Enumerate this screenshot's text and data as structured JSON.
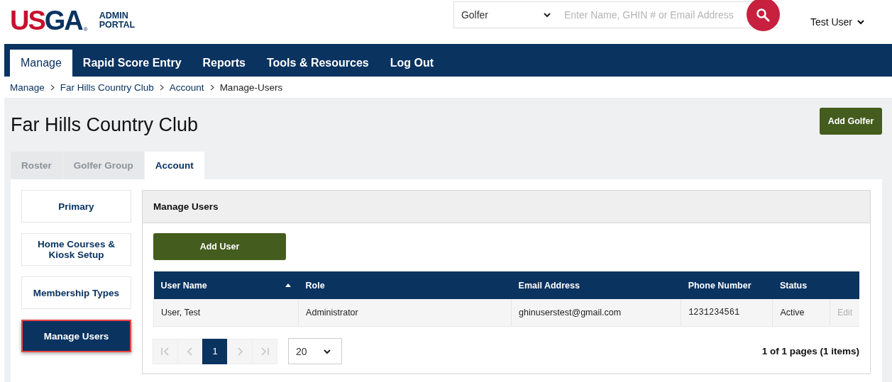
{
  "logo": {
    "parts": [
      {
        "text": "US",
        "color": "#c8102e"
      },
      {
        "text": "GA",
        "color": "#0a3360"
      }
    ],
    "mark": "®",
    "caption": [
      "ADMIN",
      "PORTAL"
    ]
  },
  "search": {
    "scope": "Golfer",
    "placeholder": "Enter Name, GHIN # or Email Address"
  },
  "user_menu": {
    "label": "Test User"
  },
  "nav": [
    {
      "label": "Manage",
      "selected": true
    },
    {
      "label": "Rapid Score Entry",
      "selected": false
    },
    {
      "label": "Reports",
      "selected": false
    },
    {
      "label": "Tools & Resources",
      "selected": false
    },
    {
      "label": "Log Out",
      "selected": false
    }
  ],
  "breadcrumbs": [
    "Manage",
    "Far Hills Country Club",
    "Account",
    "Manage-Users"
  ],
  "page": {
    "title": "Far Hills Country Club",
    "action": "Add Golfer"
  },
  "tabs": [
    {
      "label": "Roster",
      "selected": false
    },
    {
      "label": "Golfer Group",
      "selected": false
    },
    {
      "label": "Account",
      "selected": true
    }
  ],
  "side_menu": [
    {
      "label": "Primary",
      "selected": false
    },
    {
      "label": "Home Courses & Kiosk Setup",
      "selected": false
    },
    {
      "label": "Membership Types",
      "selected": false
    },
    {
      "label": "Manage Users",
      "selected": true
    }
  ],
  "panel": {
    "title": "Manage Users",
    "action": "Add User"
  },
  "table": {
    "columns": [
      {
        "label": "User Name",
        "sorted": true
      },
      {
        "label": "Role",
        "sorted": false
      },
      {
        "label": "Email Address",
        "sorted": false
      },
      {
        "label": "Phone Number",
        "sorted": false
      },
      {
        "label": "Status",
        "sorted": false
      }
    ],
    "rows": [
      {
        "cells": [
          "User, Test",
          "Administrator",
          "ghinuserstest@gmail.com",
          "1231234561",
          "Active"
        ],
        "action": {
          "label": "Edit",
          "disabled": true
        }
      }
    ]
  },
  "pagination": {
    "first_disabled": true,
    "prev_disabled": true,
    "next_disabled": true,
    "last_disabled": true,
    "pages": [
      {
        "label": "1",
        "selected": true
      }
    ],
    "page_size": "20",
    "summary": "1 of 1 pages (1 items)"
  }
}
